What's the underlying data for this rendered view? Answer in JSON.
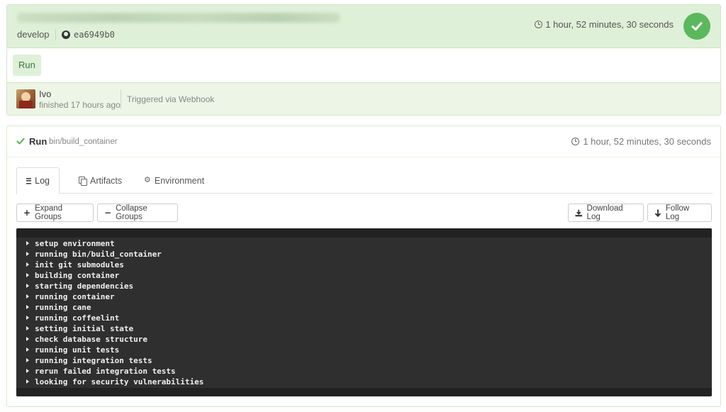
{
  "build": {
    "branch": "develop",
    "commit_sha": "ea6949b0",
    "duration": "1 hour, 52 minutes, 30 seconds",
    "status_icon": "check-icon",
    "status_color": "#5cb85c",
    "pipeline_step": "Run",
    "author": {
      "name": "Ivo",
      "finished": "finished 17 hours ago"
    },
    "trigger": "Triggered via Webhook"
  },
  "job": {
    "name": "Run",
    "command": "bin/build_container",
    "duration": "1 hour, 52 minutes, 30 seconds",
    "tabs": [
      {
        "label": "Log",
        "icon": "list-icon",
        "active": true
      },
      {
        "label": "Artifacts",
        "icon": "copy-icon",
        "active": false
      },
      {
        "label": "Environment",
        "icon": "gears-icon",
        "active": false
      }
    ],
    "buttons": {
      "expand": "Expand Groups",
      "collapse": "Collapse Groups",
      "download": "Download Log",
      "follow": "Follow Log"
    },
    "log_groups": [
      "setup environment",
      "running bin/build_container",
      "init git submodules",
      "building container",
      "starting dependencies",
      "running container",
      "running cane",
      "running coffeelint",
      "setting initial state",
      "check database structure",
      "running unit tests",
      "running integration tests",
      "rerun failed integration tests",
      "looking for security vulnerabilities"
    ]
  }
}
